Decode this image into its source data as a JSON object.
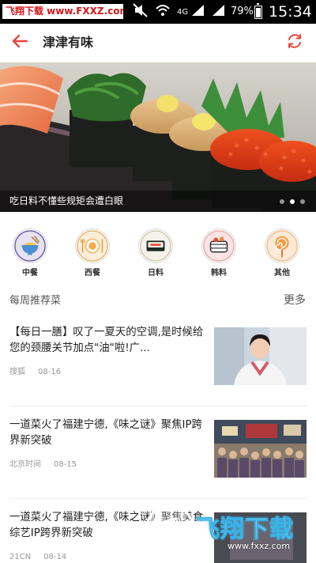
{
  "status_bar": {
    "watermark_text": "飞翔下载 www.FXXZ.com",
    "network_label": "4G",
    "battery_percent": "79%",
    "battery_level": 0.79,
    "time": "15:34"
  },
  "header": {
    "title": "津津有味",
    "back_icon": "back-arrow-icon",
    "refresh_icon": "refresh-icon",
    "accent_color": "#e8473d"
  },
  "banner": {
    "caption": "吃日料不懂些规矩会遭白眼",
    "slide_count": 3,
    "active_slide": 2
  },
  "categories": [
    {
      "label": "中餐",
      "icon": "chinese-food-bowl-icon"
    },
    {
      "label": "西餐",
      "icon": "western-food-plate-icon"
    },
    {
      "label": "日料",
      "icon": "sushi-icon"
    },
    {
      "label": "韩料",
      "icon": "korean-food-icon"
    },
    {
      "label": "其他",
      "icon": "lollipop-icon"
    }
  ],
  "section": {
    "title": "每周推荐菜",
    "more_label": "更多"
  },
  "news": [
    {
      "title": "【每日一膳】叹了一夏天的空调,是时候给您的颈腰关节加点\"油\"啦!广...",
      "source": "搜狐",
      "date": "08-16"
    },
    {
      "title": "一道菜火了福建宁德,《味之谜》聚焦IP跨界新突破",
      "source": "北京时间",
      "date": "08-15"
    },
    {
      "title": "一道菜火了福建宁德,《味之谜》聚焦美食综艺IP跨界新突破",
      "source": "21CN",
      "date": "08-14"
    }
  ],
  "watermark_bottom": {
    "text": "飞翔下载",
    "url": "www.fxxz.com"
  }
}
